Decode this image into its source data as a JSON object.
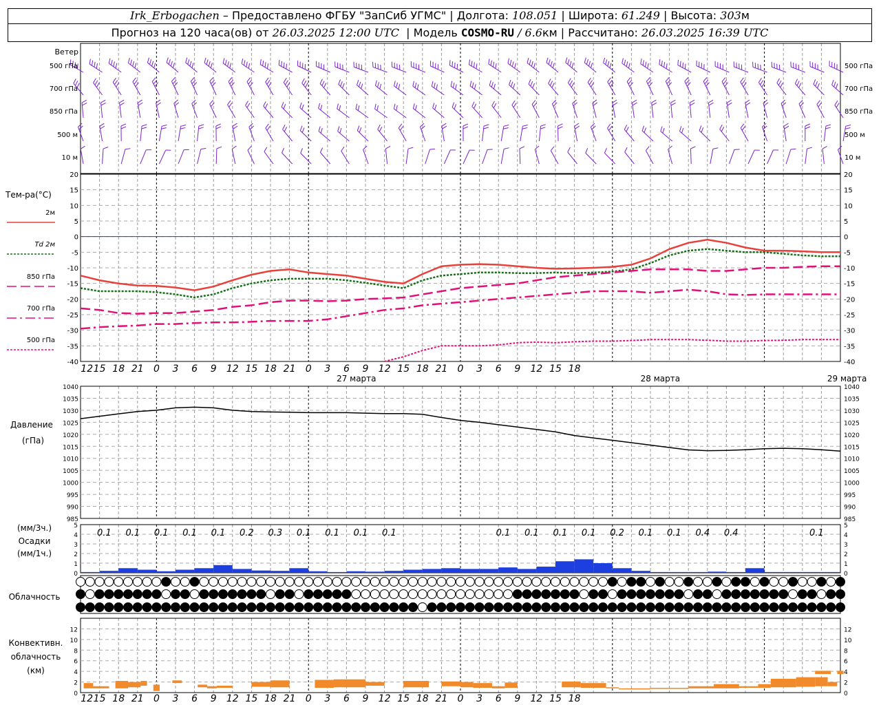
{
  "header": {
    "station": "Irk_Erbogachen",
    "provider": "–  Предоставлено ФГБУ \"ЗапСиб УГМС\"",
    "lon_label": "Долгота:",
    "lon": "108.051",
    "lat_label": "Широта:",
    "lat": "61.249",
    "alt_label": "Высота:",
    "alt": "303",
    "alt_unit": "м",
    "forecast_label": "Прогноз на 120 часа(ов) от",
    "forecast_time": "26.03.2025 12:00 UTC",
    "model_label": "Модель",
    "model": "COSMO-RU",
    "resolution": "/ 6.6",
    "res_unit": "км",
    "calc_label": "Рассчитано:",
    "calc_time": "26.03.2025 16:39 UTC"
  },
  "colors": {
    "t2m": "#e8403a",
    "td2m": "#157015",
    "t850": "#e0107a",
    "t700": "#e0107a",
    "t500": "#e0107a",
    "wind": "#7b22cc",
    "zero": "#2233cc",
    "pressure": "#000000",
    "precip": "#1e3fe0",
    "conv": "#f08a2a"
  },
  "chart_data": [
    {
      "type": "wind_barbs",
      "title": "Ветер",
      "levels": [
        "500 гПа",
        "700 гПа",
        "850 гПа",
        "500 м",
        "10 м"
      ]
    },
    {
      "type": "line",
      "title": "Тем-ра(°C)",
      "ylim": [
        -40,
        20
      ],
      "yticks": [
        20,
        15,
        10,
        5,
        0,
        -5,
        -10,
        -15,
        -20,
        -25,
        -30,
        -35,
        -40
      ],
      "xticks": [
        "12",
        "15",
        "18",
        "21",
        "0",
        "3",
        "6",
        "9",
        "12",
        "15",
        "18",
        "21",
        "0",
        "3",
        "6",
        "9",
        "12",
        "15",
        "18",
        "21",
        "0",
        "3",
        "6",
        "9",
        "12",
        "15",
        "18"
      ],
      "dates": [
        "27 марта",
        "28 марта",
        "29 марта"
      ],
      "x_hours": [
        0,
        3,
        6,
        9,
        12,
        15,
        18,
        21,
        24,
        27,
        30,
        33,
        36,
        39,
        42,
        45,
        48,
        51,
        54,
        57,
        60,
        63,
        66,
        69,
        72,
        75,
        78,
        81,
        84,
        87,
        90,
        93,
        96,
        99,
        102,
        105,
        108,
        111,
        114,
        117,
        120
      ],
      "series": [
        {
          "name": "2м",
          "values": [
            -12.5,
            -14,
            -15,
            -15.7,
            -15.8,
            -16.3,
            -17.2,
            -16,
            -14,
            -12.2,
            -11,
            -10.5,
            -11.5,
            -12,
            -12.5,
            -13.5,
            -14.5,
            -15,
            -12,
            -9.5,
            -9,
            -8.8,
            -9,
            -9.5,
            -10,
            -10.3,
            -10.2,
            -10,
            -9.7,
            -9,
            -7,
            -4,
            -2,
            -1,
            -2,
            -3.5,
            -4.5,
            -4.5,
            -4.7,
            -5,
            -5
          ]
        },
        {
          "name": "Td 2м",
          "values": [
            -16.5,
            -17.5,
            -17.5,
            -17.5,
            -17.8,
            -18.5,
            -19.5,
            -18.5,
            -16.5,
            -15,
            -14,
            -13.5,
            -13.5,
            -13.5,
            -14,
            -14.8,
            -15.7,
            -16.5,
            -14,
            -12.5,
            -12,
            -11.5,
            -11.5,
            -11.7,
            -11.7,
            -11.5,
            -11.7,
            -11.5,
            -11.2,
            -10.5,
            -8.5,
            -6,
            -4.5,
            -4,
            -4.5,
            -5,
            -5,
            -5.5,
            -6,
            -6.3,
            -6.3
          ]
        },
        {
          "name": "850 гПа",
          "values": [
            -23,
            -23.5,
            -24.5,
            -24.7,
            -24.5,
            -24.5,
            -24,
            -23.5,
            -22.5,
            -22,
            -21,
            -20.5,
            -20.5,
            -20.7,
            -20.5,
            -20,
            -19.8,
            -19.5,
            -18.5,
            -17.5,
            -16.5,
            -16,
            -15.5,
            -15,
            -14,
            -13,
            -12.5,
            -12,
            -11.5,
            -11,
            -10.5,
            -10.5,
            -10.5,
            -11,
            -11,
            -10.5,
            -10,
            -10,
            -9.7,
            -9.5,
            -9.5
          ]
        },
        {
          "name": "700 гПа",
          "values": [
            -29.5,
            -29,
            -28.7,
            -28.5,
            -28,
            -28,
            -27.7,
            -27.5,
            -27.5,
            -27.3,
            -27,
            -27,
            -27,
            -26.5,
            -25.5,
            -24.5,
            -23.5,
            -23,
            -22,
            -21.5,
            -21,
            -20.5,
            -20,
            -19.5,
            -19,
            -18.5,
            -18,
            -17.5,
            -17.5,
            -17.5,
            -18,
            -17.5,
            -17,
            -17.5,
            -18.5,
            -18.7,
            -18.5,
            -18.5,
            -18.5,
            -18.5,
            -18.5
          ]
        },
        {
          "name": "500 гПа",
          "values": [
            null,
            null,
            null,
            null,
            null,
            null,
            null,
            null,
            null,
            null,
            null,
            null,
            null,
            null,
            null,
            null,
            -40.5,
            -38.5,
            -36.5,
            -35,
            -35,
            -35,
            -34.7,
            -34,
            -33.8,
            -34,
            -33.7,
            -33.5,
            -33.5,
            -33.3,
            -33,
            -33,
            -33,
            -33.2,
            -33.5,
            -33.5,
            -33.3,
            -33.2,
            -33,
            -33,
            -33
          ]
        }
      ]
    },
    {
      "type": "line",
      "title": "Давление",
      "ylabel": "(гПа)",
      "ylim": [
        985,
        1040
      ],
      "yticks": [
        1040,
        1035,
        1030,
        1025,
        1020,
        1015,
        1010,
        1005,
        1000,
        995,
        990,
        985
      ],
      "x_hours": [
        0,
        3,
        6,
        9,
        12,
        15,
        18,
        21,
        24,
        27,
        30,
        33,
        36,
        39,
        42,
        45,
        48,
        51,
        54,
        57,
        60,
        63,
        66,
        69,
        72,
        75,
        78,
        81,
        84,
        87,
        90,
        93,
        96,
        99,
        102,
        105,
        108,
        111,
        114,
        117,
        120
      ],
      "series": [
        {
          "name": "Давление",
          "values": [
            1026.5,
            1027.5,
            1028.5,
            1029.5,
            1030,
            1031,
            1031.3,
            1031,
            1030,
            1029.5,
            1029.3,
            1029.2,
            1029,
            1029,
            1029,
            1028.8,
            1028.6,
            1028.6,
            1028.3,
            1027,
            1025.8,
            1025,
            1024,
            1023,
            1022,
            1021,
            1019.5,
            1018.5,
            1017.5,
            1016.5,
            1015.5,
            1014.5,
            1013.5,
            1013.2,
            1013.3,
            1013.6,
            1014,
            1014.2,
            1014,
            1013.6,
            1013
          ]
        }
      ]
    },
    {
      "type": "bar",
      "title": "Осадки",
      "ylabel_top": "(мм/3ч.)",
      "ylabel_bottom": "(мм/1ч.)",
      "ylim": [
        0,
        5
      ],
      "yticks": [
        5,
        4,
        3,
        2,
        1,
        0
      ],
      "labels_3h": [
        "0.1",
        "0.1",
        "0.1",
        "0.1",
        "0.1",
        "0.2",
        "0.3",
        "0.1",
        "0.1",
        "0.1",
        "0.1",
        "",
        "",
        "",
        "0.1",
        "0.1",
        "0.1",
        "0.1",
        "0.2",
        "0.1",
        "0.1",
        "0.4",
        "0.4",
        "",
        "",
        "0.1",
        ""
      ],
      "values_1h": [
        0.02,
        0.05,
        0.12,
        0.08,
        0.04,
        0.08,
        0.12,
        0.2,
        0.1,
        0.06,
        0.05,
        0.12,
        0.04,
        0.02,
        0.04,
        0.03,
        0.05,
        0.08,
        0.1,
        0.12,
        0.1,
        0.1,
        0.14,
        0.1,
        0.16,
        0.3,
        0.35,
        0.25,
        0.12,
        0.05,
        0.02,
        0.02,
        0.02,
        0.03,
        0.02,
        0.12,
        0.02,
        0.02,
        0.02,
        0.02
      ]
    },
    {
      "type": "symbols",
      "title": "Облачность",
      "rows": 3
    },
    {
      "type": "bar",
      "title": "Конвективн. облачность (км)",
      "ylim": [
        0,
        14
      ],
      "yticks": [
        12,
        10,
        8,
        6,
        4,
        2,
        0
      ],
      "segments": [
        {
          "x0": 0.5,
          "x1": 2.0,
          "base": 0.8,
          "top": 1.8
        },
        {
          "x0": 2.0,
          "x1": 4.5,
          "base": 0.8,
          "top": 1.2
        },
        {
          "x0": 5.5,
          "x1": 7.5,
          "base": 0.8,
          "top": 2.2
        },
        {
          "x0": 7.5,
          "x1": 9.5,
          "base": 1.0,
          "top": 2.0
        },
        {
          "x0": 9.5,
          "x1": 10.5,
          "base": 1.3,
          "top": 2.2
        },
        {
          "x0": 11.5,
          "x1": 12.5,
          "base": 0.3,
          "top": 1.5
        },
        {
          "x0": 14.5,
          "x1": 16.0,
          "base": 1.8,
          "top": 2.3
        },
        {
          "x0": 18.5,
          "x1": 20.0,
          "base": 1.0,
          "top": 1.5
        },
        {
          "x0": 20.0,
          "x1": 21.5,
          "base": 0.8,
          "top": 1.2
        },
        {
          "x0": 21.5,
          "x1": 24.0,
          "base": 0.9,
          "top": 1.3
        },
        {
          "x0": 27.0,
          "x1": 30.0,
          "base": 1.1,
          "top": 2.0
        },
        {
          "x0": 30.0,
          "x1": 33.0,
          "base": 1.0,
          "top": 2.3
        },
        {
          "x0": 37.0,
          "x1": 40.0,
          "base": 0.9,
          "top": 2.4
        },
        {
          "x0": 40.0,
          "x1": 45.0,
          "base": 1.0,
          "top": 2.5
        },
        {
          "x0": 45.0,
          "x1": 48.0,
          "base": 1.3,
          "top": 2.0
        },
        {
          "x0": 51.0,
          "x1": 55.0,
          "base": 1.0,
          "top": 2.2
        },
        {
          "x0": 57.0,
          "x1": 60.0,
          "base": 1.2,
          "top": 2.1
        },
        {
          "x0": 60.0,
          "x1": 62.0,
          "base": 1.0,
          "top": 2.0
        },
        {
          "x0": 62.0,
          "x1": 65.0,
          "base": 0.9,
          "top": 1.8
        },
        {
          "x0": 65.0,
          "x1": 67.0,
          "base": 0.8,
          "top": 1.2
        },
        {
          "x0": 67.0,
          "x1": 69.0,
          "base": 0.9,
          "top": 1.9
        },
        {
          "x0": 76.0,
          "x1": 79.0,
          "base": 1.0,
          "top": 2.1
        },
        {
          "x0": 79.0,
          "x1": 83.0,
          "base": 0.9,
          "top": 1.8
        },
        {
          "x0": 83.0,
          "x1": 85.0,
          "base": 0.8,
          "top": 1.0
        },
        {
          "x0": 85.0,
          "x1": 90.0,
          "base": 0.6,
          "top": 0.8
        },
        {
          "x0": 90.0,
          "x1": 96.0,
          "base": 0.7,
          "top": 0.9
        },
        {
          "x0": 96.0,
          "x1": 100.0,
          "base": 0.8,
          "top": 1.2
        },
        {
          "x0": 100.0,
          "x1": 104.0,
          "base": 0.8,
          "top": 1.6
        },
        {
          "x0": 104.0,
          "x1": 107.0,
          "base": 0.9,
          "top": 1.2
        },
        {
          "x0": 107.0,
          "x1": 109.0,
          "base": 0.9,
          "top": 1.6
        },
        {
          "x0": 109.0,
          "x1": 113.0,
          "base": 1.0,
          "top": 2.6
        },
        {
          "x0": 113.0,
          "x1": 116.0,
          "base": 1.1,
          "top": 2.9
        },
        {
          "x0": 116.0,
          "x1": 118.0,
          "base": 1.2,
          "top": 2.9
        },
        {
          "x0": 116.0,
          "x1": 118.5,
          "base": 3.5,
          "top": 4.1
        },
        {
          "x0": 118.0,
          "x1": 119.5,
          "base": 1.2,
          "top": 2.0
        },
        {
          "x0": 119.5,
          "x1": 120.5,
          "base": 3.5,
          "top": 4.1
        }
      ]
    }
  ]
}
